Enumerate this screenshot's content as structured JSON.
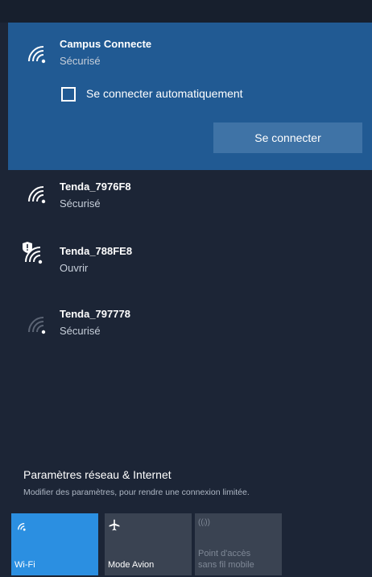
{
  "selected_network": {
    "name": "Campus Connecte",
    "status": "Sécurisé",
    "auto_connect_label": "Se connecter automatiquement",
    "auto_connect_checked": false,
    "connect_button": "Se connecter"
  },
  "networks": [
    {
      "name": "Tenda_7976F8",
      "status": "Sécurisé",
      "icon": "wifi-icon"
    },
    {
      "name": "Tenda_788FE8",
      "status": "Ouvrir",
      "icon": "wifi-shield-icon"
    },
    {
      "name": "Tenda_797778",
      "status": "Sécurisé",
      "icon": "wifi-weak-icon"
    }
  ],
  "settings": {
    "title": "Paramètres réseau & Internet",
    "subtitle": "Modifier des paramètres, pour rendre une connexion limitée."
  },
  "quick_actions": {
    "wifi": {
      "label": "Wi-Fi",
      "icon": "wifi-icon"
    },
    "airplane": {
      "label": "Mode Avion",
      "icon": "airplane-icon"
    },
    "hotspot": {
      "label_line1": "Point d'accès",
      "label_line2": "sans fil mobile",
      "icon_text": "((ᵢ))",
      "icon": "hotspot-icon"
    }
  },
  "colors": {
    "panel_bg": "#1c2536",
    "selected_bg": "#215a93",
    "accent": "#2b8fe1"
  }
}
